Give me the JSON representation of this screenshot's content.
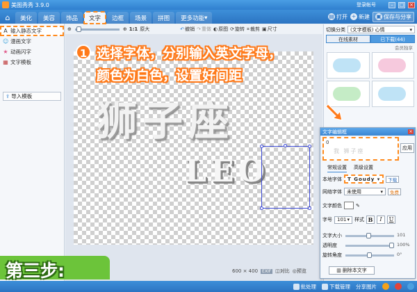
{
  "titlebar": {
    "title": "美图秀秀 3.9.0",
    "login": "登录帐号"
  },
  "nav": {
    "tabs": [
      "美化",
      "美容",
      "饰品",
      "文字",
      "边框",
      "场景",
      "拼图",
      "更多功能"
    ],
    "active_tab": "文字",
    "more_arrow": "▾",
    "open_label": "打开",
    "new_label": "新建",
    "save_label": "保存与分享"
  },
  "left_panel": {
    "items": [
      {
        "label": "输入静态文字",
        "icon": "A"
      },
      {
        "label": "漫画文字",
        "icon": "☺"
      },
      {
        "label": "动画闪字",
        "icon": "★"
      },
      {
        "label": "文字模板",
        "icon": "▦"
      }
    ],
    "import_label": "导入模板"
  },
  "toolbar": {
    "ratio_label": "1:1",
    "zoom_label": "原大",
    "undo_label": "撤销",
    "redo_label": "重做",
    "original_label": "原图",
    "rotate_label": "旋转",
    "crop_label": "裁剪",
    "size_label": "尺寸"
  },
  "canvas": {
    "main_text": "狮子座",
    "sub_text": "LEO",
    "size_text": "600 × 400",
    "exif_label": "EXIF",
    "compare_label": "对比",
    "preview_label": "预览"
  },
  "callout": {
    "step_number": "1",
    "line1": "选择字体，分别输入英文字母，",
    "line2": "颜色为白色，设置好间距"
  },
  "right_panel": {
    "category_label": "切换分类",
    "category_value": "(文字模板) 心情",
    "tab_online": "在线素材",
    "tab_downloaded": "已下载(44)",
    "member_label": "会员独享"
  },
  "dialog": {
    "title": "文字编辑框",
    "input_cursor": "0",
    "input_ghost": "我  狮子座",
    "apply_label": "应用",
    "tab_general": "常规设置",
    "tab_advanced": "高级设置",
    "local_font_label": "本地字体",
    "local_font_value": "Goudy",
    "local_font_prefix": "T",
    "download_label": "下载",
    "web_font_label": "网络字体",
    "web_font_value": "未使用",
    "free_label": "免费",
    "color_label": "文字颜色",
    "size_label": "字号",
    "size_value": "101",
    "style_label": "样式",
    "bold_label": "B",
    "italic_label": "I",
    "underline_label": "U",
    "prop_size_label": "文字大小",
    "prop_size_value": "101",
    "prop_opacity_label": "透明度",
    "prop_opacity_value": "100%",
    "prop_rotate_label": "旋转角度",
    "prop_rotate_value": "0°",
    "delete_label": "删除本文字"
  },
  "step3": {
    "label": "第三步:"
  },
  "statusbar": {
    "batch_label": "批处理",
    "download_label": "下载管理",
    "share_label": "分享图片"
  },
  "colors": {
    "accent": "#ff7a1a",
    "brand_blue": "#2c74c2",
    "step_green": "#6cc43a"
  }
}
